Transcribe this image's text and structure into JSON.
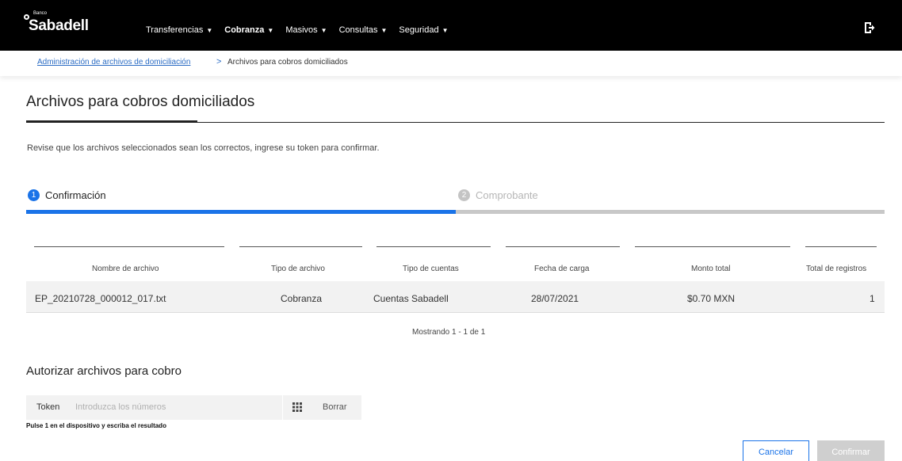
{
  "header": {
    "logo_small": "Banco",
    "logo_main": "Sabadell",
    "nav": [
      {
        "label": "Transferencias"
      },
      {
        "label": "Cobranza",
        "active": true
      },
      {
        "label": "Masivos"
      },
      {
        "label": "Consultas"
      },
      {
        "label": "Seguridad"
      }
    ],
    "logout_icon": "logout-icon"
  },
  "breadcrumb": {
    "link": "Administración de archivos de domiciliación",
    "separator": ">",
    "current": "Archivos para cobros domiciliados"
  },
  "page": {
    "title": "Archivos para cobros domiciliados",
    "subtitle": "Revise que los archivos seleccionados sean los correctos, ingrese su token para confirmar."
  },
  "stepper": {
    "steps": [
      {
        "number": "1",
        "label": "Confirmación",
        "active": true
      },
      {
        "number": "2",
        "label": "Comprobante",
        "active": false
      }
    ],
    "progress_fraction": 0.5,
    "colors": {
      "active": "#1a73e8",
      "inactive": "#c8c8c8"
    }
  },
  "table": {
    "headers": [
      "Nombre de archivo",
      "Tipo de archivo",
      "Tipo de cuentas",
      "Fecha de carga",
      "Monto total",
      "Total de registros"
    ],
    "rows": [
      [
        "EP_20210728_000012_017.txt",
        "Cobranza",
        "Cuentas Sabadell",
        "28/07/2021",
        "$0.70 MXN",
        "1"
      ]
    ],
    "showing": "Mostrando 1 - 1 de 1"
  },
  "auth": {
    "title": "Autorizar archivos para cobro",
    "token_label": "Token",
    "token_placeholder": "Introduzca los números",
    "token_value": "",
    "keypad_icon": "keypad-grid-icon",
    "clear_label": "Borrar",
    "hint": "Pulse 1 en el dispositivo y escriba el resultado"
  },
  "actions": {
    "cancel": "Cancelar",
    "confirm": "Confirmar"
  }
}
